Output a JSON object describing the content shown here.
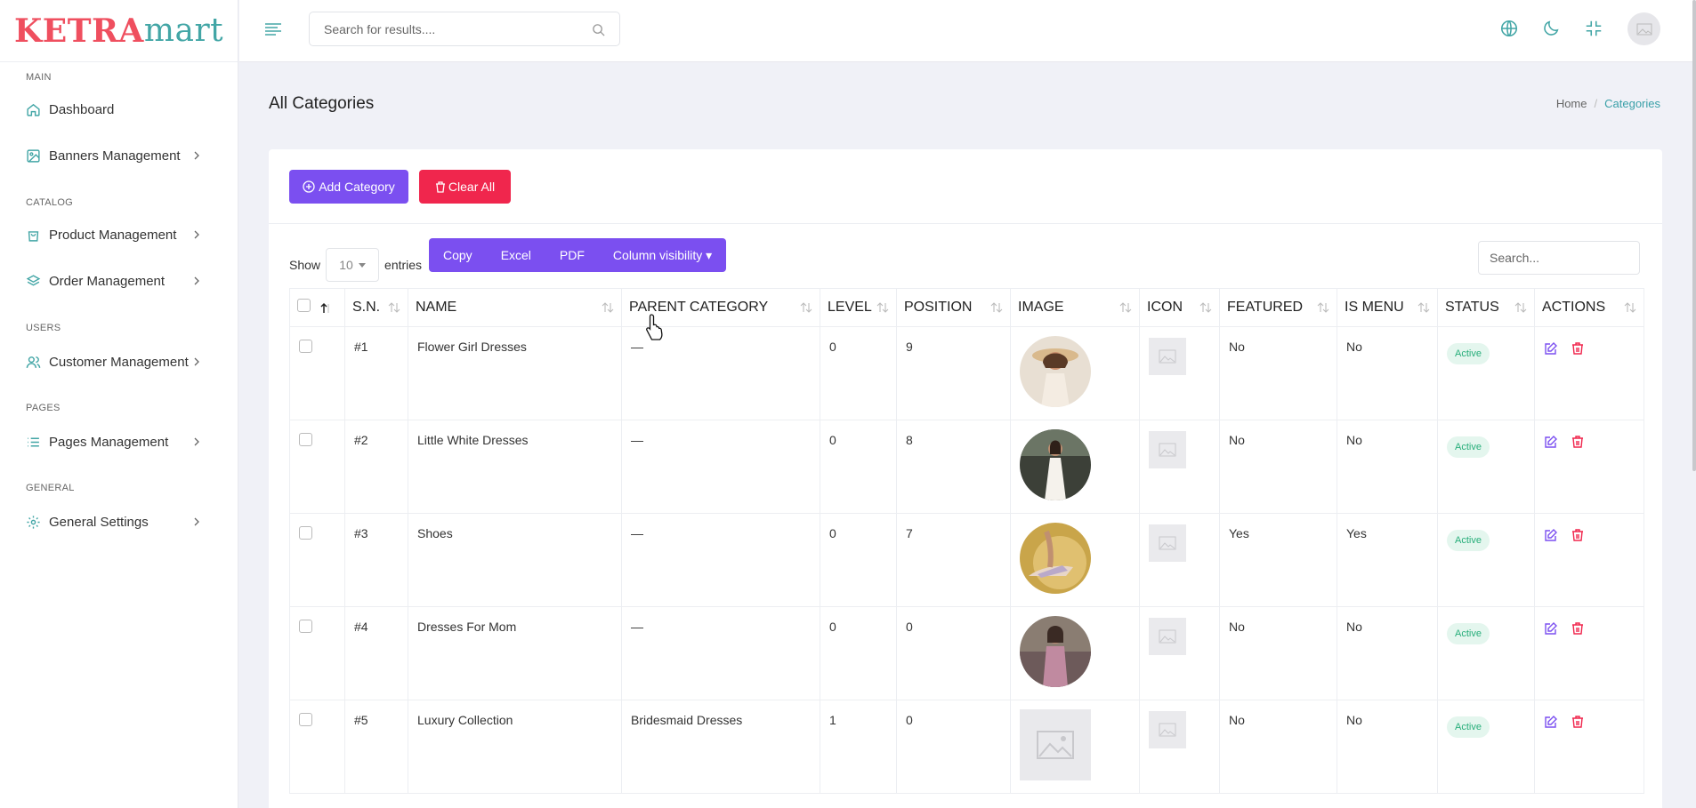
{
  "brand": {
    "part1": "KETRA",
    "part2": "mart"
  },
  "sidebar": {
    "sections": [
      {
        "label": "MAIN"
      },
      {
        "label": "CATALOG"
      },
      {
        "label": "USERS"
      },
      {
        "label": "PAGES"
      },
      {
        "label": "GENERAL"
      }
    ],
    "items": [
      {
        "label": "Dashboard"
      },
      {
        "label": "Banners Management"
      },
      {
        "label": "Product Management"
      },
      {
        "label": "Order Management"
      },
      {
        "label": "Customer Management"
      },
      {
        "label": "Pages Management"
      },
      {
        "label": "General Settings"
      }
    ]
  },
  "topbar": {
    "search_placeholder": "Search for results...."
  },
  "page": {
    "title": "All Categories",
    "breadcrumb": [
      "Home",
      "Categories"
    ],
    "breadcrumb_sep": "/"
  },
  "toolbar": {
    "add_label": "Add Category",
    "clear_label": "Clear All"
  },
  "table_controls": {
    "show_label": "Show",
    "entries_value": "10",
    "entries_label": "entries",
    "export_buttons": [
      "Copy",
      "Excel",
      "PDF",
      "Column visibility"
    ],
    "search_placeholder": "Search..."
  },
  "table": {
    "headers": [
      "S.N.",
      "NAME",
      "PARENT CATEGORY",
      "LEVEL",
      "POSITION",
      "IMAGE",
      "ICON",
      "FEATURED",
      "IS MENU",
      "STATUS",
      "ACTIONS"
    ],
    "rows": [
      {
        "sn": "#1",
        "name": "Flower Girl Dresses",
        "parent": "—",
        "level": "0",
        "position": "9",
        "featured": "No",
        "is_menu": "No",
        "status": "Active",
        "image": "photo-girl-hat"
      },
      {
        "sn": "#2",
        "name": "Little White Dresses",
        "parent": "—",
        "level": "0",
        "position": "8",
        "featured": "No",
        "is_menu": "No",
        "status": "Active",
        "image": "photo-white-dress"
      },
      {
        "sn": "#3",
        "name": "Shoes",
        "parent": "—",
        "level": "0",
        "position": "7",
        "featured": "Yes",
        "is_menu": "Yes",
        "status": "Active",
        "image": "photo-shoes"
      },
      {
        "sn": "#4",
        "name": "Dresses For Mom",
        "parent": "—",
        "level": "0",
        "position": "0",
        "featured": "No",
        "is_menu": "No",
        "status": "Active",
        "image": "photo-mom"
      },
      {
        "sn": "#5",
        "name": "Luxury Collection",
        "parent": "Bridesmaid Dresses",
        "level": "1",
        "position": "0",
        "featured": "No",
        "is_menu": "No",
        "status": "Active",
        "image": "image-placeholder"
      }
    ]
  },
  "colors": {
    "accent": "#7b4ff0",
    "danger": "#f0264d",
    "brand_red": "#ef4f5f",
    "brand_teal": "#43a6a6",
    "success": "#27ae7a"
  }
}
